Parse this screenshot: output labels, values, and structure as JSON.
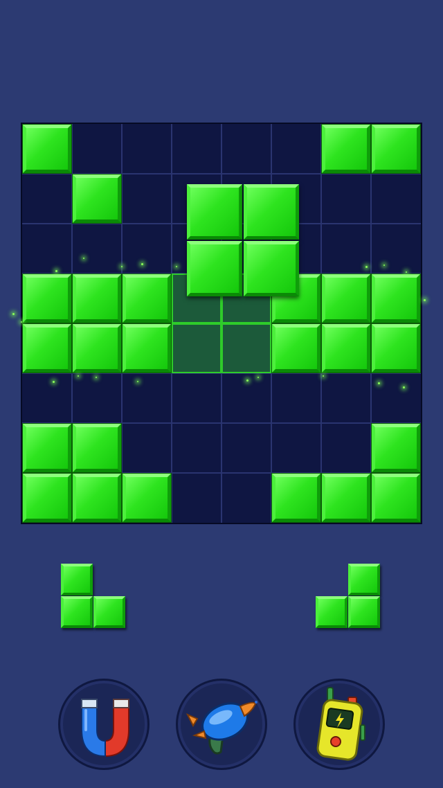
{
  "board": {
    "rows": 8,
    "cols": 8,
    "filled": [
      [
        1,
        0,
        0,
        0,
        0,
        0,
        1,
        1
      ],
      [
        0,
        1,
        0,
        0,
        0,
        0,
        0,
        0
      ],
      [
        0,
        0,
        0,
        0,
        0,
        0,
        0,
        0
      ],
      [
        1,
        1,
        1,
        0,
        0,
        1,
        1,
        1
      ],
      [
        1,
        1,
        1,
        0,
        0,
        1,
        1,
        1
      ],
      [
        0,
        0,
        0,
        0,
        0,
        0,
        0,
        0
      ],
      [
        1,
        1,
        0,
        0,
        0,
        0,
        0,
        1
      ],
      [
        1,
        1,
        1,
        0,
        0,
        1,
        1,
        1
      ]
    ],
    "placement_hint_cells": [
      [
        3,
        3
      ],
      [
        3,
        4
      ],
      [
        4,
        3
      ],
      [
        4,
        4
      ]
    ]
  },
  "dragged_piece": {
    "shape": [
      [
        1,
        1
      ],
      [
        1,
        1
      ]
    ]
  },
  "tray": [
    {
      "shape": [
        [
          1,
          0
        ],
        [
          1,
          1
        ]
      ]
    },
    {
      "shape": [
        [
          0,
          1
        ],
        [
          1,
          1
        ]
      ]
    }
  ],
  "boosters": [
    {
      "icon": "magnet-icon"
    },
    {
      "icon": "rocket-blaster-icon"
    },
    {
      "icon": "walkie-talkie-icon"
    }
  ],
  "colors": {
    "background": "#2c3a72",
    "board": "#0f1642",
    "block": "#2ee41f",
    "hint": "#1c5a3a"
  }
}
